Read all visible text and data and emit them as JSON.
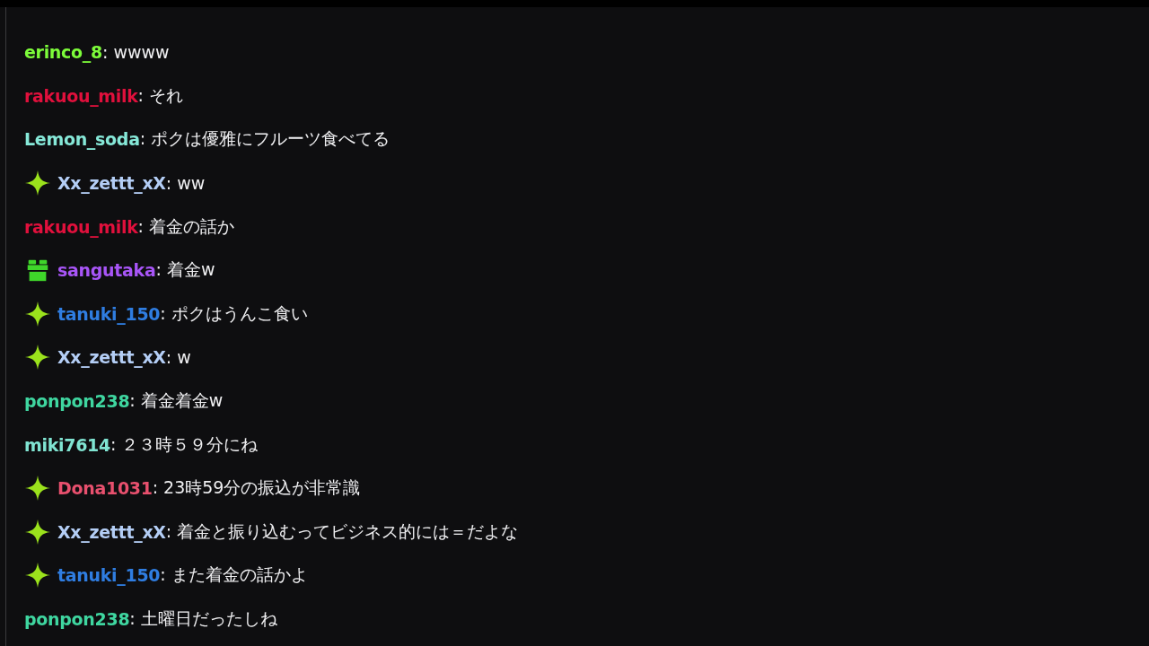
{
  "chat": {
    "messages": [
      {
        "kind": "plain",
        "username": "erinco_8",
        "color": "#7dfc3a",
        "text": ": wwww"
      },
      {
        "kind": "plain",
        "username": "rakuou_milk",
        "color": "#e0103c",
        "text": ": それ"
      },
      {
        "kind": "plain",
        "username": "Lemon_soda",
        "color": "#86e8d8",
        "text": ": ポクは優雅にフルーツ食べてる"
      },
      {
        "kind": "sparkle",
        "username": "Xx_zettt_xX",
        "color": "#b4cef6",
        "text": ": ww"
      },
      {
        "kind": "plain",
        "username": "rakuou_milk",
        "color": "#e0103c",
        "text": ": 着金の話か"
      },
      {
        "kind": "gift",
        "username": "sangutaka",
        "color": "#a855f7",
        "text": ": 着金w"
      },
      {
        "kind": "sparkle",
        "username": "tanuki_150",
        "color": "#2f7de1",
        "text": ": ポクはうんこ食い"
      },
      {
        "kind": "sparkle",
        "username": "Xx_zettt_xX",
        "color": "#b4cef6",
        "text": ": w"
      },
      {
        "kind": "plain",
        "username": "ponpon238",
        "color": "#3fd6a0",
        "text": ": 着金着金w"
      },
      {
        "kind": "plain",
        "username": "miki7614",
        "color": "#80e4d2",
        "text": ": ２３時５９分にね"
      },
      {
        "kind": "sparkle",
        "username": "Dona1031",
        "color": "#e8506e",
        "text": ": 23時59分の振込が非常識"
      },
      {
        "kind": "sparkle",
        "username": "Xx_zettt_xX",
        "color": "#b4cef6",
        "text": ": 着金と振り込むってビジネス的には＝だよな"
      },
      {
        "kind": "sparkle",
        "username": "tanuki_150",
        "color": "#2f7de1",
        "text": ": また着金の話かよ"
      },
      {
        "kind": "plain",
        "username": "ponpon238",
        "color": "#3fd6a0",
        "text": ": 土曜日だったしね"
      }
    ]
  }
}
